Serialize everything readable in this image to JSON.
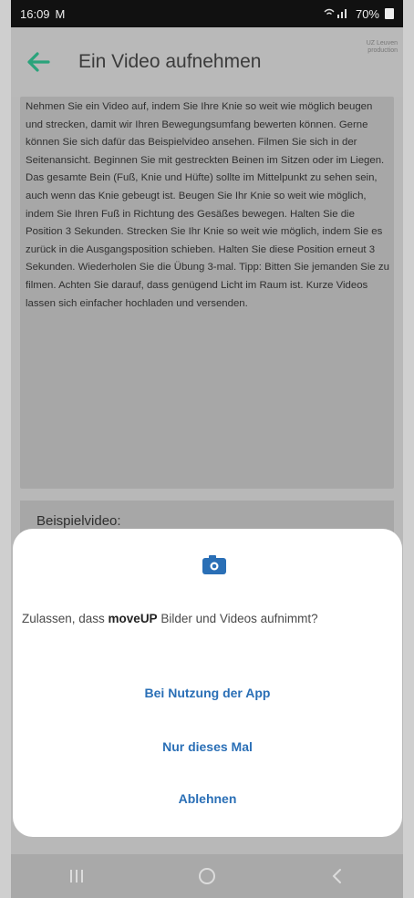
{
  "status_bar": {
    "time": "16:09",
    "notification_icon": "M",
    "signal_icon": "wifi-signal-icon",
    "battery": "70%"
  },
  "app_bar": {
    "title": "Ein Video aufnehmen",
    "back_icon": "arrow-left-icon",
    "logo_text": "UZ Leuven\nproduction"
  },
  "instructions": {
    "text": "Nehmen Sie ein Video auf, indem Sie Ihre Knie so weit wie möglich beugen und strecken, damit wir Ihren Bewegungsumfang bewerten können. Gerne können Sie sich dafür das Beispielvideo ansehen. Filmen Sie sich in der Seitenansicht. Beginnen Sie mit gestreckten Beinen im Sitzen oder im Liegen. Das gesamte Bein (Fuß, Knie und Hüfte) sollte im Mittelpunkt zu sehen sein, auch wenn das Knie gebeugt ist. Beugen Sie Ihr Knie so weit wie möglich, indem Sie Ihren Fuß in Richtung des Gesäßes bewegen. Halten Sie die Position 3 Sekunden. Strecken Sie Ihr Knie so weit wie möglich, indem Sie es zurück in die Ausgangsposition schieben. Halten Sie diese Position erneut 3 Sekunden. Wiederholen Sie die Übung 3-mal. Tipp: Bitten Sie jemanden Sie zu filmen. Achten Sie darauf, dass genügend Licht im Raum ist. Kurze Videos lassen sich einfacher hochladen und versenden."
  },
  "example": {
    "label": "Beispielvideo:"
  },
  "dialog": {
    "icon": "camera-icon",
    "message_prefix": "Zulassen, dass ",
    "app_name": "moveUP",
    "message_suffix": " Bilder und Videos aufnimmt?",
    "buttons": {
      "while_using": "Bei Nutzung der App",
      "only_this_time": "Nur dieses Mal",
      "deny": "Ablehnen"
    },
    "accent_color": "#2a6fb6"
  },
  "nav_bar": {
    "recents_icon": "recents-icon",
    "home_icon": "home-icon",
    "back_icon": "nav-back-icon"
  }
}
